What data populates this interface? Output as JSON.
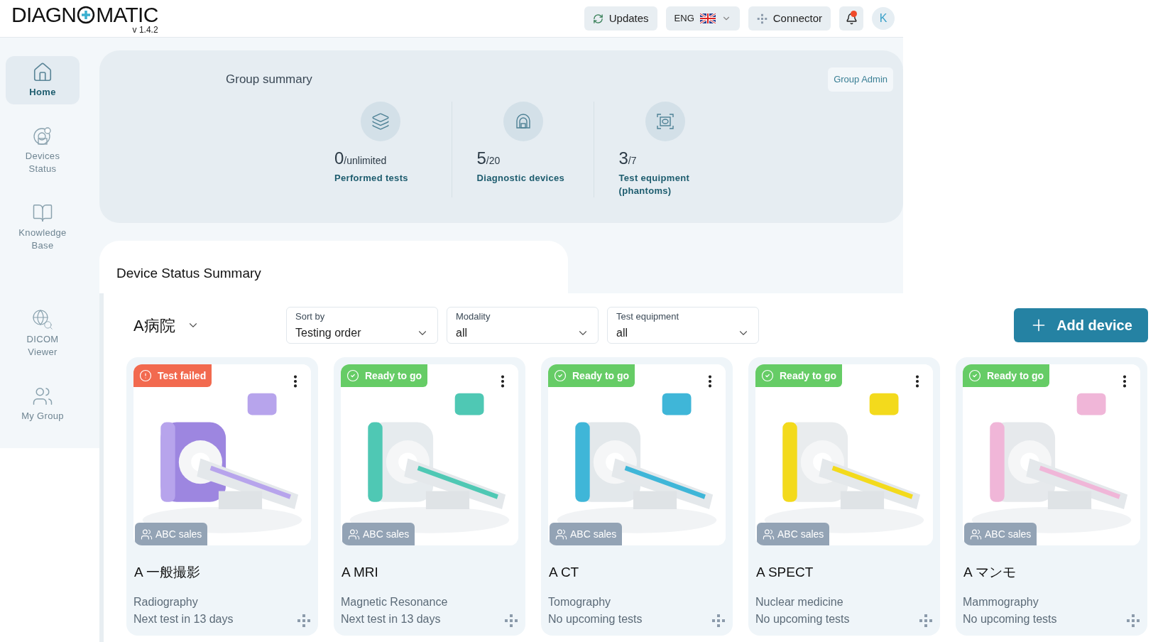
{
  "header": {
    "logo_left": "DIAGN",
    "logo_right": "MATIC",
    "version": "v 1.4.2",
    "updates": "Updates",
    "language": "ENG",
    "connector": "Connector",
    "notification": true,
    "avatar": "K"
  },
  "sidebar": {
    "items": [
      {
        "label": "Home",
        "selected": true
      },
      {
        "label": "Devices Status",
        "selected": false
      },
      {
        "label": "Knowledge Base",
        "selected": false
      },
      {
        "label": "DICOM Viewer",
        "selected": false
      },
      {
        "label": "My Group",
        "selected": false
      }
    ]
  },
  "group_summary": {
    "title": "Group summary",
    "admin_button": "Group Admin",
    "stats": [
      {
        "value": "0",
        "total": "/unlimited",
        "label": "Performed tests"
      },
      {
        "value": "5",
        "total": "/20",
        "label": "Diagnostic devices"
      },
      {
        "value": "3",
        "total": "/7",
        "label": "Test equipment (phantoms)"
      }
    ]
  },
  "device_status": {
    "title": "Device Status Summary",
    "hospital": "A病院",
    "filters": [
      {
        "label": "Sort by",
        "value": "Testing order"
      },
      {
        "label": "Modality",
        "value": "all"
      },
      {
        "label": "Test equipment",
        "value": "all"
      }
    ],
    "add_button": "Add device",
    "devices": [
      {
        "kind": "failed",
        "status_label": "Test failed",
        "group": "ABC sales",
        "name": "A 一般撮影",
        "modality": "Radiography",
        "next_test": "Next test in 13 days"
      },
      {
        "kind": "ready",
        "status_label": "Ready to go",
        "group": "ABC sales",
        "name": "A MRI",
        "modality": "Magnetic Resonance",
        "next_test": "Next test in 13 days"
      },
      {
        "kind": "ready",
        "status_label": "Ready to go",
        "group": "ABC sales",
        "name": "A CT",
        "modality": "Tomography",
        "next_test": "No upcoming tests"
      },
      {
        "kind": "ready",
        "status_label": "Ready to go",
        "group": "ABC sales",
        "name": "A SPECT",
        "modality": "Nuclear medicine",
        "next_test": "No upcoming tests"
      },
      {
        "kind": "ready",
        "status_label": "Ready to go",
        "group": "ABC sales",
        "name": "A マンモ",
        "modality": "Mammography",
        "next_test": "No upcoming tests"
      }
    ]
  }
}
